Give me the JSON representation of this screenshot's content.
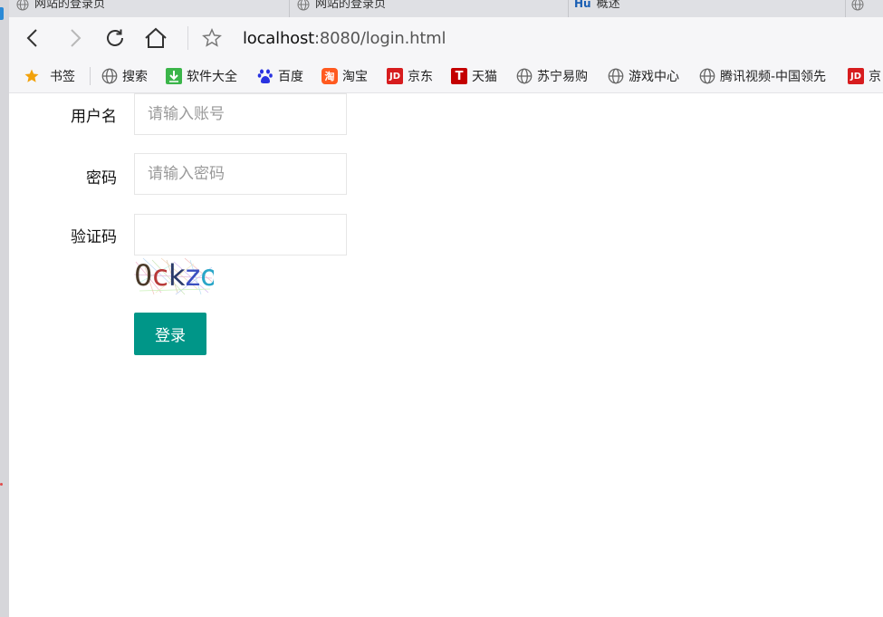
{
  "tabs": [
    {
      "title": "网站的登录页",
      "icon": "globe-icon"
    },
    {
      "title": "网站的登录页",
      "icon": "globe-icon"
    },
    {
      "title": "概述",
      "icon": "hu-icon",
      "icon_text": "Hu"
    },
    {
      "title": "",
      "icon": "globe-icon"
    }
  ],
  "toolbar": {
    "url_host": "localhost",
    "url_rest": ":8080/login.html"
  },
  "bookmarks": [
    {
      "label": "书签",
      "icon": "star-icon"
    },
    {
      "label": "搜索",
      "icon": "globe-icon"
    },
    {
      "label": "软件大全",
      "icon": "download-icon"
    },
    {
      "label": "百度",
      "icon": "baidu-paw-icon"
    },
    {
      "label": "淘宝",
      "icon": "taobao-icon",
      "icon_text": "淘"
    },
    {
      "label": "京东",
      "icon": "jd-icon",
      "icon_text": "JD"
    },
    {
      "label": "天猫",
      "icon": "tmall-icon",
      "icon_text": "T"
    },
    {
      "label": "苏宁易购",
      "icon": "globe-icon"
    },
    {
      "label": "游戏中心",
      "icon": "globe-icon"
    },
    {
      "label": "腾讯视频-中国领先",
      "icon": "globe-icon"
    },
    {
      "label": "京",
      "icon": "jd-icon",
      "icon_text": "JD"
    }
  ],
  "form": {
    "username_label": "用户名",
    "username_placeholder": "请输入账号",
    "password_label": "密码",
    "password_placeholder": "请输入密码",
    "captcha_label": "验证码",
    "captcha_value": "",
    "captcha_chars": [
      {
        "ch": "0",
        "color": "#4a3a2a"
      },
      {
        "ch": "c",
        "color": "#b83a3a"
      },
      {
        "ch": "k",
        "color": "#2a3a6a"
      },
      {
        "ch": "z",
        "color": "#3a4fc0"
      },
      {
        "ch": "o",
        "color": "#2aa6c8"
      }
    ],
    "login_label": "登录"
  },
  "colors": {
    "accent": "#009688"
  }
}
